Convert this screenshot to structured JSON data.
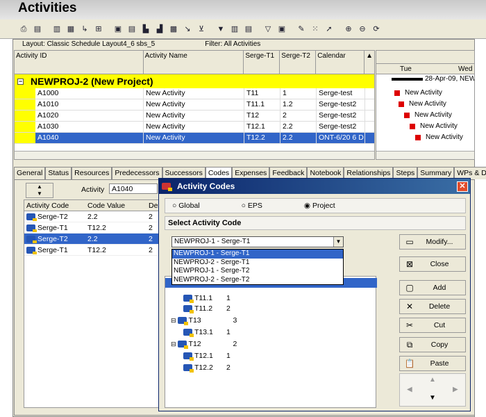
{
  "app": {
    "title": "Activities"
  },
  "toolbar": {
    "icons": [
      "print-icon",
      "print-preview-icon",
      "columns-icon",
      "bars-icon",
      "relationships-icon",
      "network-icon",
      "layout-icon",
      "table-icon",
      "chart-icon",
      "histogram-icon",
      "spreadsheet-icon",
      "progress-icon",
      "trace-icon",
      "filter-icon",
      "group-icon",
      "sort-icon",
      "outline-icon",
      "schedule-icon",
      "level-icon",
      "assign-icon",
      "zoom-in-icon",
      "zoom-out-icon",
      "navigate-icon"
    ]
  },
  "layout": {
    "label": "Layout: Classic Schedule Layout4_6 sbs_5",
    "filter": "Filter: All Activities"
  },
  "grid": {
    "headers": [
      "Activity ID",
      "Activity Name",
      "Serge-T1",
      "Serge-T2",
      "Calendar"
    ],
    "project": "NEWPROJ-2  (New Project)",
    "rows": [
      {
        "id": "A1000",
        "name": "New Activity",
        "t1": "T11",
        "t2": "1",
        "cal": "Serge-test"
      },
      {
        "id": "A1010",
        "name": "New Activity",
        "t1": "T11.1",
        "t2": "1.2",
        "cal": "Serge-test2"
      },
      {
        "id": "A1020",
        "name": "New Activity",
        "t1": "T12",
        "t2": "2",
        "cal": "Serge-test2"
      },
      {
        "id": "A1030",
        "name": "New Activity",
        "t1": "T12.1",
        "t2": "2.2",
        "cal": "Serge-test2"
      },
      {
        "id": "A1040",
        "name": "New Activity",
        "t1": "T12.2",
        "t2": "2.2",
        "cal": "ONT-6/20 6 D"
      }
    ]
  },
  "gantt": {
    "days": [
      "Tue",
      "Wed"
    ],
    "milestone": "28-Apr-09, NEWI",
    "bars": [
      "New Activity",
      "New Activity",
      "New Activity",
      "New Activity",
      "New Activity"
    ]
  },
  "tabs": [
    "General",
    "Status",
    "Resources",
    "Predecessors",
    "Successors",
    "Codes",
    "Expenses",
    "Feedback",
    "Notebook",
    "Relationships",
    "Steps",
    "Summary",
    "WPs & Docs"
  ],
  "detail": {
    "activity_label": "Activity",
    "activity_value": "A1040",
    "headers": [
      "Activity Code",
      "Code Value",
      "Des"
    ],
    "rows": [
      {
        "code": "Serge-T2",
        "value": "2.2",
        "des": "2"
      },
      {
        "code": "Serge-T1",
        "value": "T12.2",
        "des": "2"
      },
      {
        "code": "Serge-T2",
        "value": "2.2",
        "des": "2"
      },
      {
        "code": "Serge-T1",
        "value": "T12.2",
        "des": "2"
      }
    ]
  },
  "dialog": {
    "title": "Activity Codes",
    "radios": [
      "Global",
      "EPS",
      "Project"
    ],
    "selected_radio": "Project",
    "section": "Select Activity Code",
    "combo_value": "NEWPROJ-1 - Serge-T1",
    "dropdown": [
      "NEWPROJ-1 - Serge-T1",
      "NEWPROJ-2 - Serge-T1",
      "NEWPROJ-1 - Serge-T2",
      "NEWPROJ-2 - Serge-T2"
    ],
    "tree": [
      {
        "code": "T11.1",
        "v": "1"
      },
      {
        "code": "T11.2",
        "v": "2"
      },
      {
        "code": "T13",
        "v": "3"
      },
      {
        "code": "T13.1",
        "v": "1"
      },
      {
        "code": "T12",
        "v": "2"
      },
      {
        "code": "T12.1",
        "v": "1"
      },
      {
        "code": "T12.2",
        "v": "2"
      }
    ],
    "buttons": [
      "Modify...",
      "Close",
      "Add",
      "Delete",
      "Cut",
      "Copy",
      "Paste"
    ]
  }
}
